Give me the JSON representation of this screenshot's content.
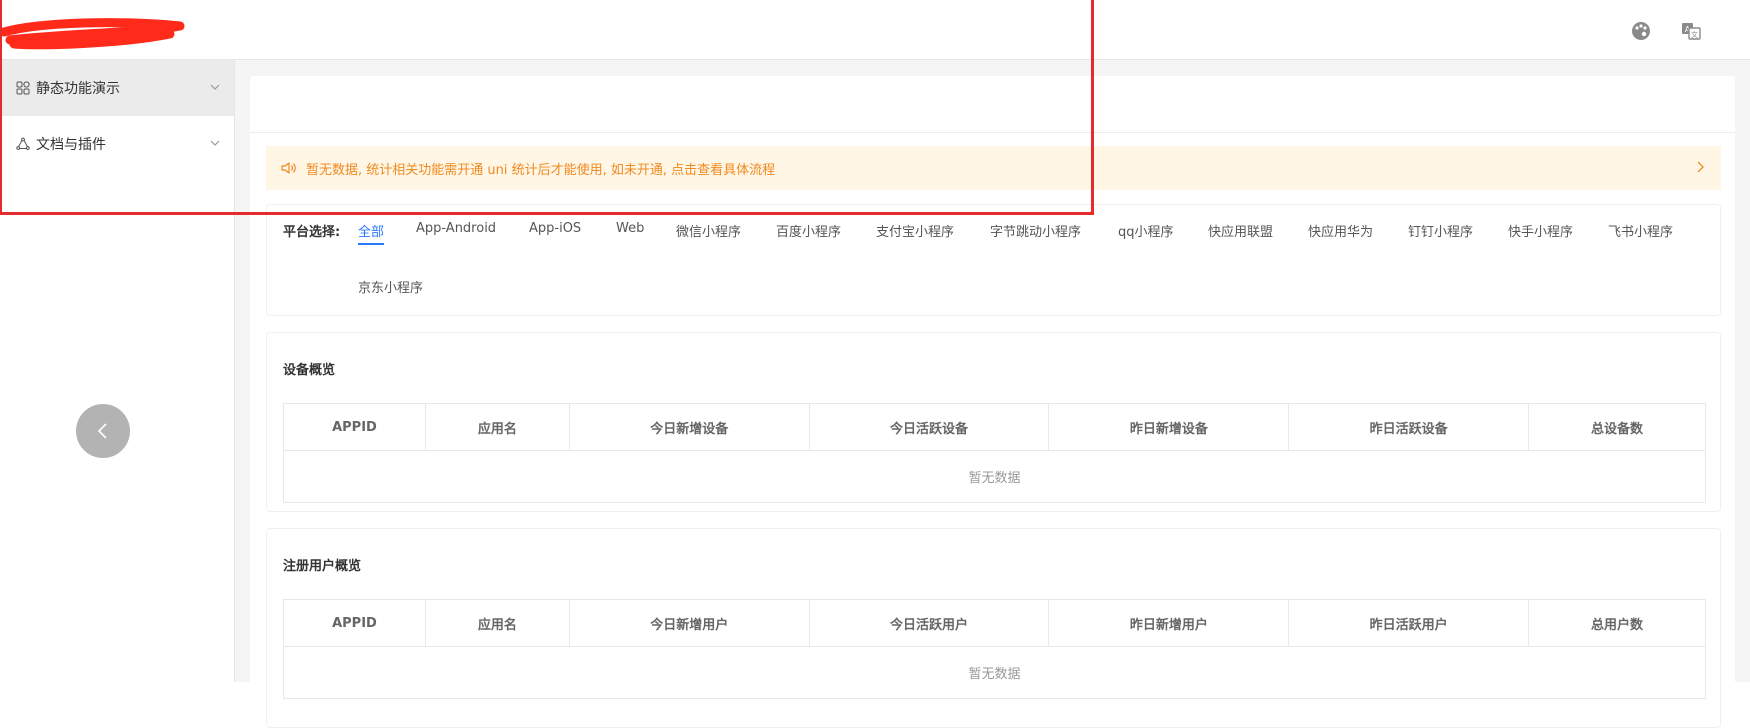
{
  "colors": {
    "accent": "#2979ff",
    "notice_text": "#f0891e",
    "notice_bg": "#fff6e6",
    "annotation": "#e52b2b",
    "redaction": "#ff2a1a"
  },
  "topbar": {
    "icons": [
      "palette-icon",
      "translate-icon"
    ]
  },
  "sidebar": {
    "items": [
      {
        "label": "静态功能演示",
        "icon": "grid-apps-icon",
        "active": true
      },
      {
        "label": "文档与插件",
        "icon": "plugin-icon",
        "active": false
      }
    ],
    "collapse_icon": "chevron-left-icon"
  },
  "notice": {
    "text": "暂无数据, 统计相关功能需开通 uni 统计后才能使用, 如未开通, 点击查看具体流程"
  },
  "platform": {
    "label": "平台选择:",
    "tabs": [
      "全部",
      "App-Android",
      "App-iOS",
      "Web",
      "微信小程序",
      "百度小程序",
      "支付宝小程序",
      "字节跳动小程序",
      "qq小程序",
      "快应用联盟",
      "快应用华为",
      "钉钉小程序",
      "快手小程序",
      "飞书小程序",
      "京东小程序"
    ],
    "selected": "全部"
  },
  "device_overview": {
    "title": "设备概览",
    "columns": [
      "APPID",
      "应用名",
      "今日新增设备",
      "今日活跃设备",
      "昨日新增设备",
      "昨日活跃设备",
      "总设备数"
    ],
    "empty_text": "暂无数据"
  },
  "user_overview": {
    "title": "注册用户概览",
    "columns": [
      "APPID",
      "应用名",
      "今日新增用户",
      "今日活跃用户",
      "昨日新增用户",
      "昨日活跃用户",
      "总用户数"
    ],
    "empty_text": "暂无数据"
  }
}
